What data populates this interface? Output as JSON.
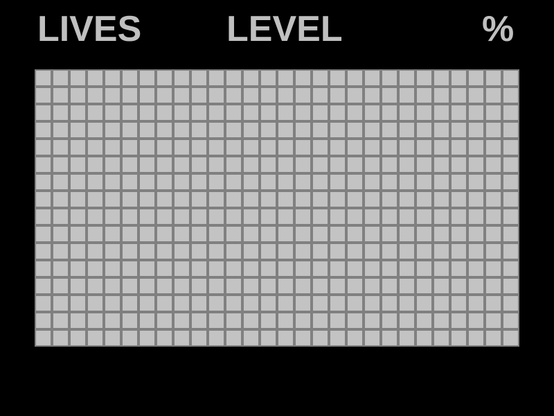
{
  "hud": {
    "lives_label": "LIVES",
    "level_label": "LEVEL",
    "percent_label": "%"
  },
  "board": {
    "columns": 28,
    "rows": 16,
    "cell_state": "unfilled"
  },
  "colors": {
    "background": "#000000",
    "hud_text": "#c0c0c0",
    "cell_fill": "#c3c3c3",
    "grid_line": "#808080"
  }
}
